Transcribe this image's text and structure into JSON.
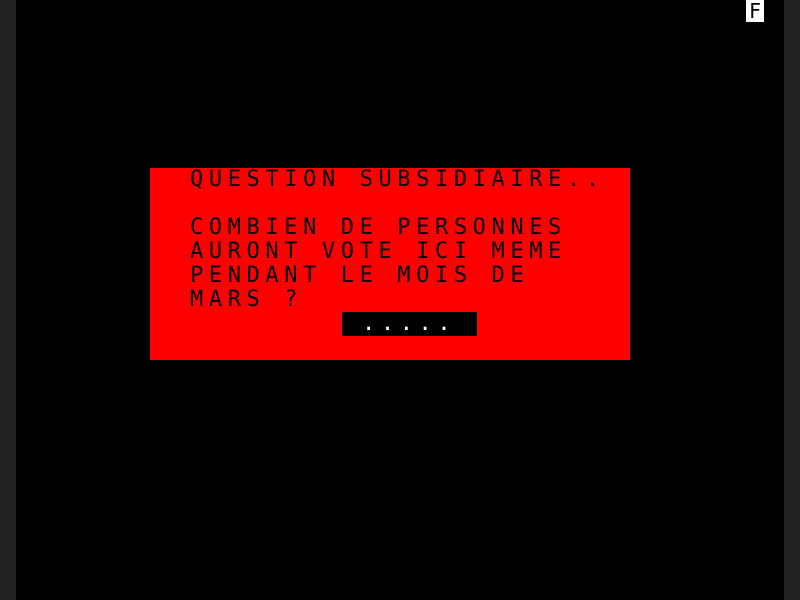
{
  "status": {
    "indicator": "F"
  },
  "dialog": {
    "title": "QUESTION SUBSIDIAIRE..",
    "question_lines": [
      "COMBIEN DE PERSONNES",
      "AURONT VOTE ICI MEME",
      "PENDANT LE MOIS DE",
      "MARS ?"
    ],
    "answer_placeholder": "....."
  },
  "colors": {
    "background": "#000000",
    "dialog": "#ff0000",
    "text": "#000000",
    "input_text": "#ffffff"
  }
}
